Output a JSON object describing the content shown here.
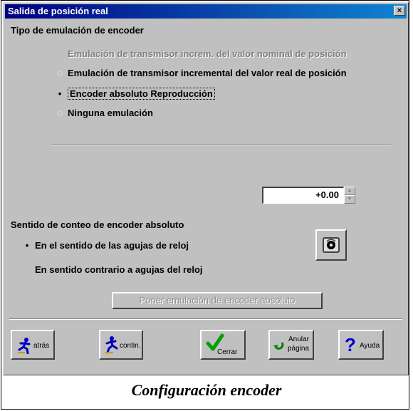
{
  "window": {
    "title": "Salida de posición real",
    "close_symbol": "×"
  },
  "section_encoder": {
    "heading": "Tipo de emulación de encoder",
    "options": [
      {
        "label": "Emulación de transmisor increm. del valor nominal de posición",
        "state": "disabled"
      },
      {
        "label": "Emulación de transmisor incremental del valor real de posición",
        "state": "unselected"
      },
      {
        "label": "Encoder absoluto Reproducción",
        "state": "selected"
      },
      {
        "label": "Ninguna emulación",
        "state": "unselected"
      }
    ]
  },
  "numeric_value": "+0.00",
  "section_count": {
    "heading": "Sentido de conteo de encoder absoluto",
    "options": [
      {
        "label": "En el sentido de las agujas de reloj",
        "state": "selected"
      },
      {
        "label": "En sentido contrario a agujas del reloj",
        "state": "unselected"
      }
    ]
  },
  "set_button": "Poner emulación de encoder absoluto",
  "buttons": {
    "back": "atrás",
    "continue": "contin.",
    "close": "Cerrar",
    "cancel_line1": "Anular",
    "cancel_line2": "página",
    "help": "Ayuda"
  },
  "caption": "Configuración encoder",
  "colors": {
    "title_start": "#000080",
    "title_end": "#1084d0",
    "dialog": "#c0c0c0"
  },
  "icons": [
    "runner-back-icon",
    "runner-forward-icon",
    "check-icon",
    "undo-arrow-icon",
    "question-icon",
    "dial-icon"
  ]
}
